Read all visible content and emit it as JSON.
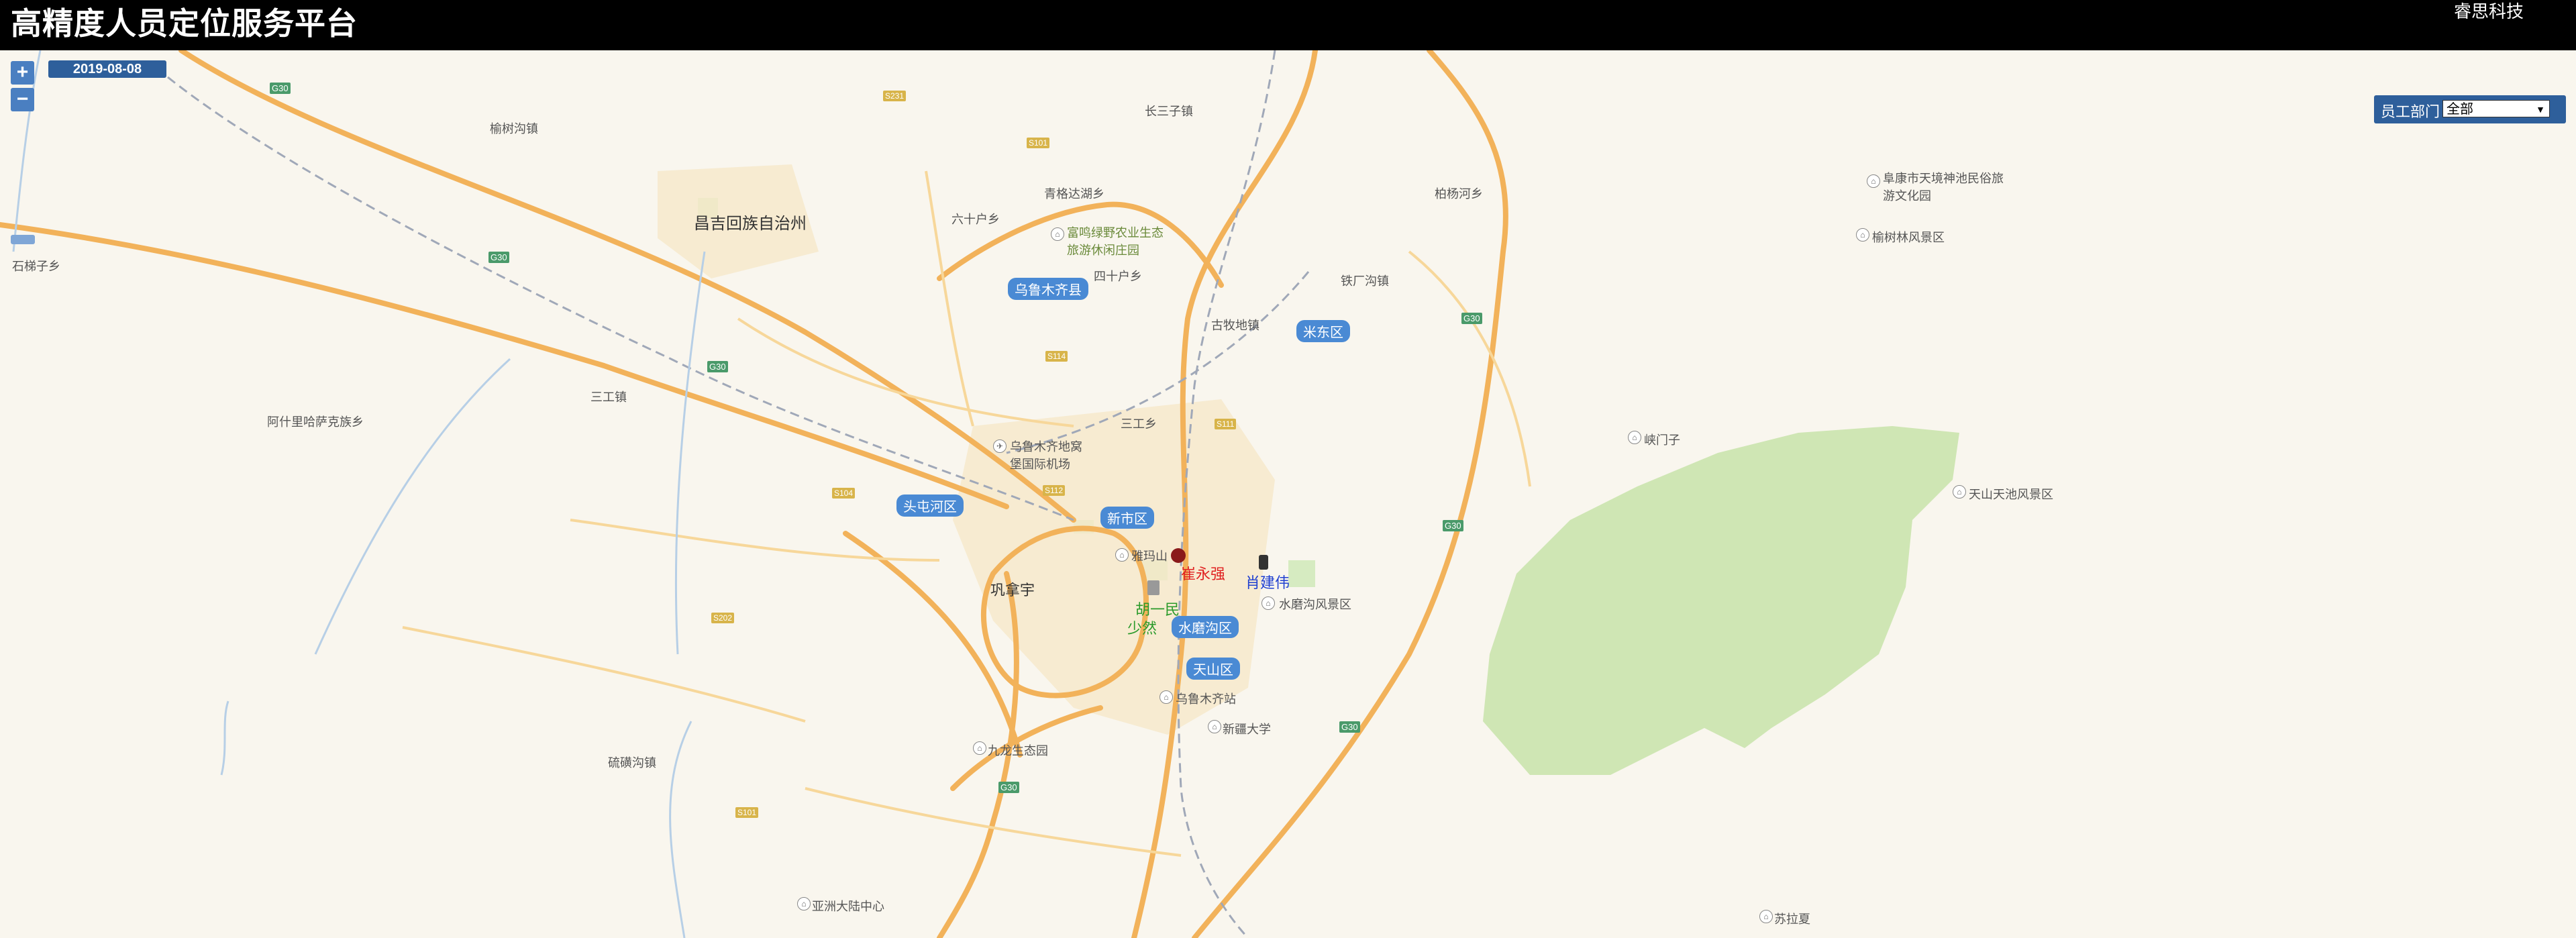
{
  "header": {
    "title": "高精度人员定位服务平台",
    "logo_alt": "睿思科技"
  },
  "controls": {
    "zoom_in": "+",
    "zoom_out": "−",
    "date": "2019-08-08"
  },
  "filter": {
    "label": "员工部门",
    "selected": "全部"
  },
  "districts": [
    "乌鲁木齐县",
    "米东区",
    "头屯河区",
    "新市区",
    "水磨沟区",
    "天山区"
  ],
  "places": {
    "changji": "昌吉回族自治州",
    "yushugou": "榆树沟镇",
    "liushihu": "六十户乡",
    "qinggeda": "青格达湖乡",
    "changsanzi": "长三子镇",
    "baiyanghe": "柏杨河乡",
    "sanping": "三工镇",
    "sanpingxiang": "三工乡",
    "ashli": "阿什里哈萨克族乡",
    "shitizi": "石梯子乡",
    "sishihu": "四十户乡",
    "gumudi": "古牧地镇",
    "tiechanggou": "铁厂沟镇",
    "airport": "乌鲁木齐地窝堡国际机场",
    "gongshan": "巩拿宇",
    "yaminshan": "雅玛山",
    "shuimogou_scenic": "水磨沟风景区",
    "station": "乌鲁木齐站",
    "xjdaxue": "新疆大学",
    "jiulong": "九龙生态园",
    "liuhuang": "硫磺沟镇",
    "yazhou": "亚洲大陆中心",
    "xiamenzi": "峡门子",
    "tianchi": "天山天池风景区",
    "fukang": "阜康市天境神池民俗旅游文化园",
    "yushulin": "榆树林风景区",
    "sulaping": "苏拉夏",
    "nongye": "富鸣绿野农业生态旅游休闲庄园"
  },
  "highways": [
    "G30",
    "G30",
    "G30",
    "G30",
    "G30",
    "G30",
    "G30",
    "S231",
    "S101",
    "S114",
    "S111",
    "S104",
    "S112",
    "S202",
    "S101"
  ],
  "people": [
    {
      "name": "崔永强",
      "color": "#e02020"
    },
    {
      "name": "肖建伟",
      "color": "#2040d0"
    },
    {
      "name": "胡一民",
      "color": "#2a9a2a"
    },
    {
      "name": "少然",
      "color": "#2a9a2a"
    }
  ]
}
